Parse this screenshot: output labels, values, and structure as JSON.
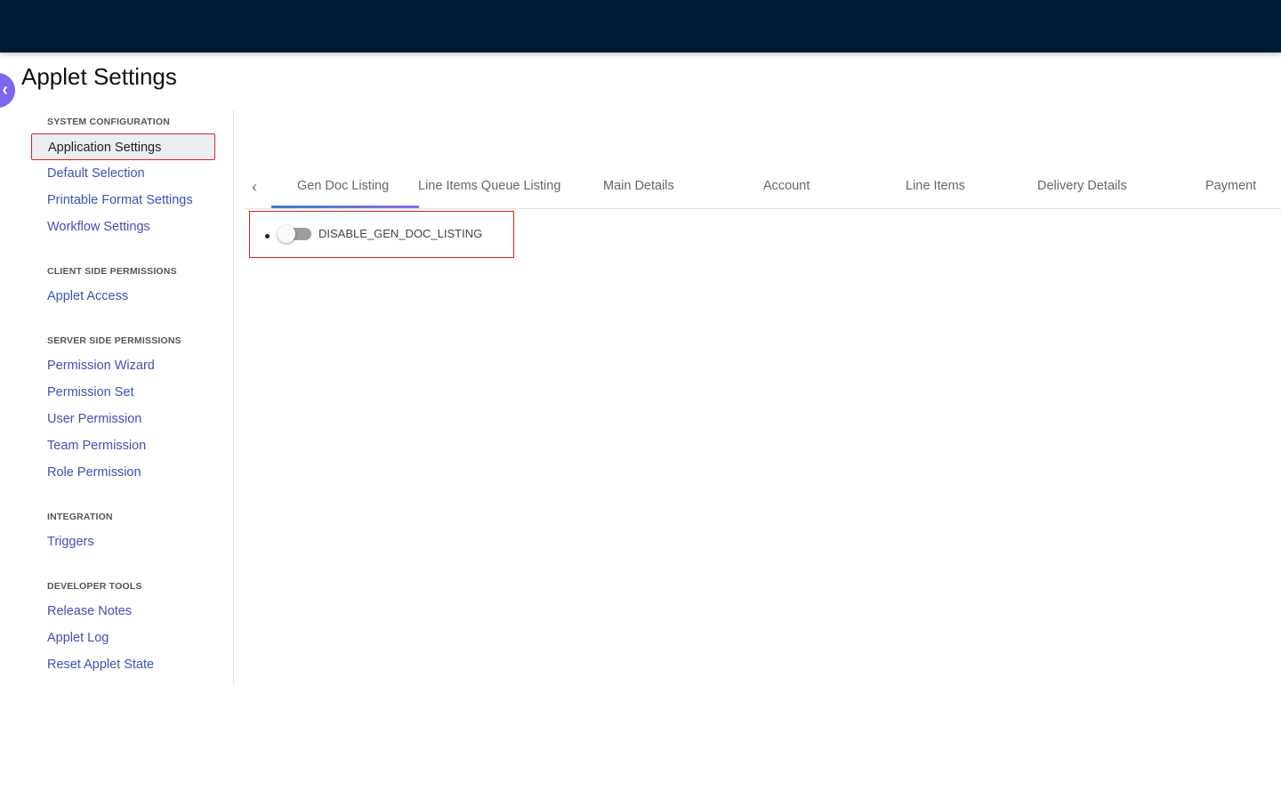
{
  "page": {
    "title": "Applet Settings"
  },
  "sidebar": {
    "sections": [
      {
        "heading": "SYSTEM CONFIGURATION",
        "items": [
          "Application Settings",
          "Default Selection",
          "Printable Format Settings",
          "Workflow Settings"
        ]
      },
      {
        "heading": "CLIENT SIDE PERMISSIONS",
        "items": [
          "Applet Access"
        ]
      },
      {
        "heading": "SERVER SIDE PERMISSIONS",
        "items": [
          "Permission Wizard",
          "Permission Set",
          "User Permission",
          "Team Permission",
          "Role Permission"
        ]
      },
      {
        "heading": "INTEGRATION",
        "items": [
          "Triggers"
        ]
      },
      {
        "heading": "DEVELOPER TOOLS",
        "items": [
          "Release Notes",
          "Applet Log",
          "Reset Applet State"
        ]
      }
    ]
  },
  "tabs": [
    "Gen Doc Listing",
    "Line Items Queue Listing",
    "Main Details",
    "Account",
    "Line Items",
    "Delivery Details",
    "Payment"
  ],
  "setting": {
    "label": "DISABLE_GEN_DOC_LISTING",
    "enabled": false
  }
}
